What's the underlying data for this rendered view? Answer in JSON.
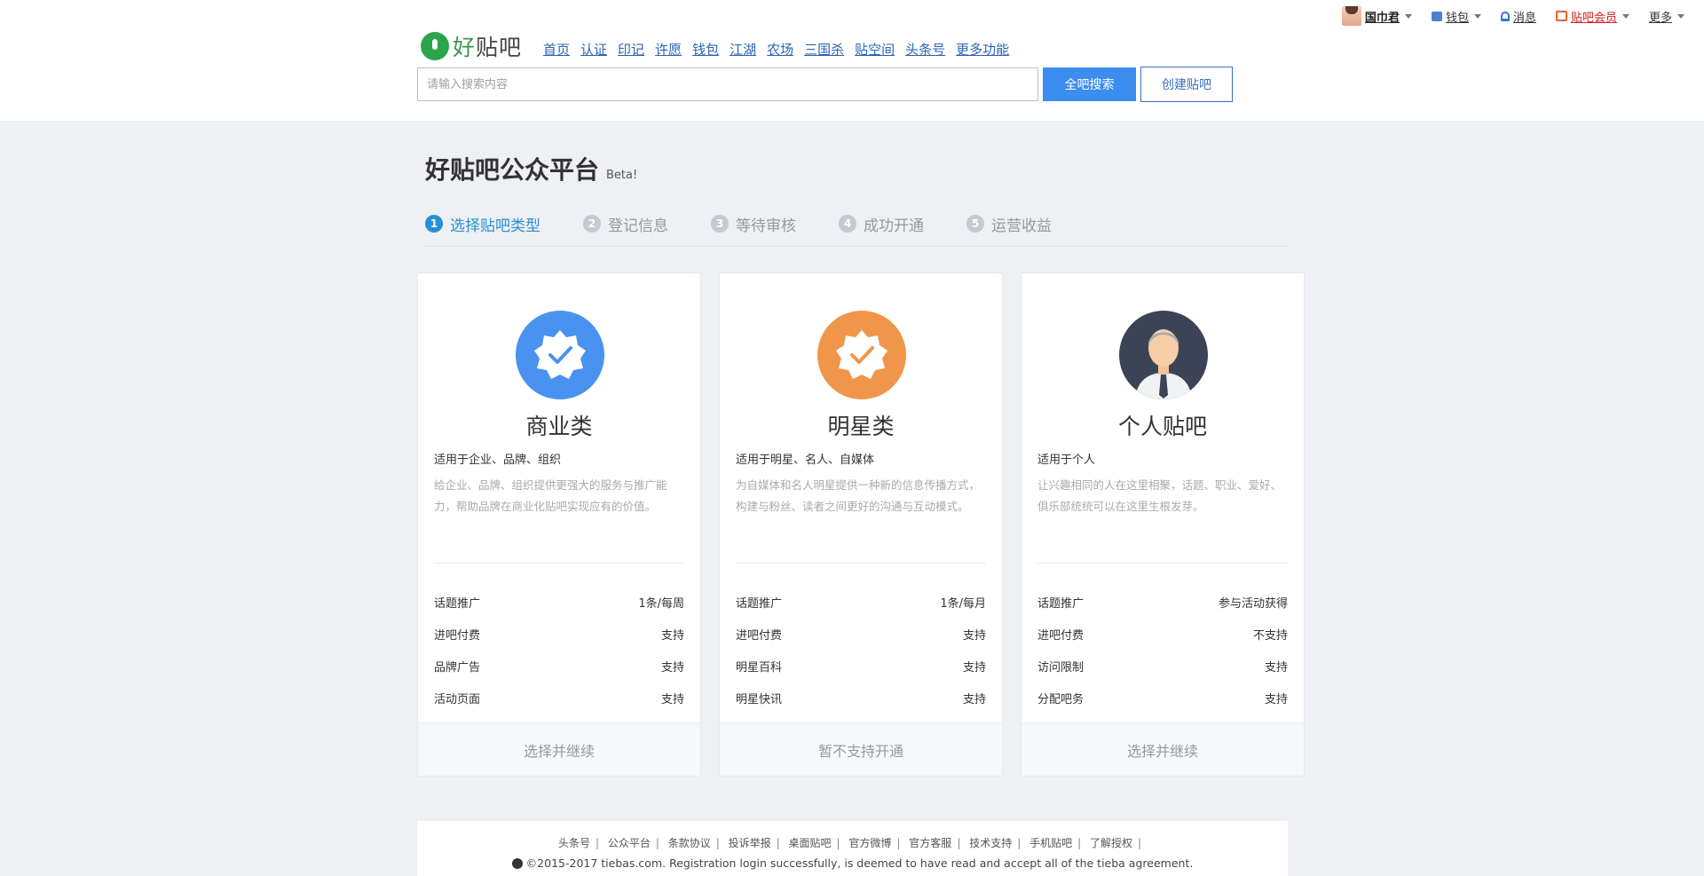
{
  "userbar": {
    "username": "国巾君",
    "wallet": "钱包",
    "messages": "消息",
    "vip": "贴吧会员",
    "more": "更多"
  },
  "header": {
    "logo_part1": "好",
    "logo_part2": "贴吧",
    "nav": [
      "首页",
      "认证",
      "印记",
      "许愿",
      "钱包",
      "江湖",
      "农场",
      "三国杀",
      "贴空间",
      "头条号",
      "更多功能"
    ],
    "search_placeholder": "请输入搜索内容",
    "search_button": "全吧搜索",
    "create_button": "创建贴吧"
  },
  "platform": {
    "title": "好贴吧公众平台",
    "badge": "Beta!"
  },
  "steps": [
    {
      "num": "1",
      "label": "选择贴吧类型"
    },
    {
      "num": "2",
      "label": "登记信息"
    },
    {
      "num": "3",
      "label": "等待审核"
    },
    {
      "num": "4",
      "label": "成功开通"
    },
    {
      "num": "5",
      "label": "运营收益"
    }
  ],
  "cards": [
    {
      "title": "商业类",
      "subtitle": "适用于企业、品牌、组织",
      "description": "给企业、品牌、组织提供更强大的服务与推广能力，帮助品牌在商业化贴吧实现应有的价值。",
      "features": [
        {
          "name": "话题推广",
          "value": "1条/每周"
        },
        {
          "name": "进吧付费",
          "value": "支持"
        },
        {
          "name": "品牌广告",
          "value": "支持"
        },
        {
          "name": "活动页面",
          "value": "支持"
        }
      ],
      "action": "选择并继续",
      "icon_color": "#4a92ef"
    },
    {
      "title": "明星类",
      "subtitle": "适用于明星、名人、自媒体",
      "description": "为自媒体和名人明星提供一种新的信息传播方式，构建与粉丝、读者之间更好的沟通与互动模式。",
      "features": [
        {
          "name": "话题推广",
          "value": "1条/每月"
        },
        {
          "name": "进吧付费",
          "value": "支持"
        },
        {
          "name": "明星百科",
          "value": "支持"
        },
        {
          "name": "明星快讯",
          "value": "支持"
        }
      ],
      "action": "暂不支持开通",
      "icon_color": "#f0964a"
    },
    {
      "title": "个人贴吧",
      "subtitle": "适用于个人",
      "description": "让兴趣相同的人在这里相聚，话题、职业、爱好、俱乐部统统可以在这里生根发芽。",
      "features": [
        {
          "name": "话题推广",
          "value": "参与活动获得"
        },
        {
          "name": "进吧付费",
          "value": "不支持"
        },
        {
          "name": "访问限制",
          "value": "支持"
        },
        {
          "name": "分配吧务",
          "value": "支持"
        }
      ],
      "action": "选择并继续",
      "icon_color": "#3b4456"
    }
  ],
  "footer": {
    "links": [
      "头条号",
      "公众平台",
      "条款协议",
      "投诉举报",
      "桌面贴吧",
      "官方微博",
      "官方客服",
      "技术支持",
      "手机贴吧",
      "了解授权"
    ],
    "copyright": "©2015-2017 tiebas.com. Registration login successfully, is deemed to have read and accept all of the tieba agreement."
  }
}
